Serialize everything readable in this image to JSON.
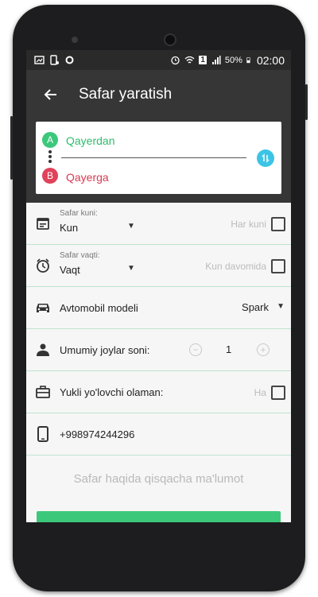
{
  "status_bar": {
    "battery": "50%",
    "time": "02:00",
    "sim": "1"
  },
  "app_bar": {
    "title": "Safar yaratish"
  },
  "route": {
    "from_badge": "A",
    "from_label": "Qayerdan",
    "to_badge": "B",
    "to_label": "Qayerga"
  },
  "date_row": {
    "label": "Safar kuni:",
    "value": "Kun",
    "daily_label": "Har kuni"
  },
  "time_row": {
    "label": "Safar vaqti:",
    "value": "Vaqt",
    "all_day_label": "Kun davomida"
  },
  "car_row": {
    "label": "Avtomobil modeli",
    "value": "Spark"
  },
  "seats_row": {
    "label": "Umumiy joylar soni:",
    "count": "1"
  },
  "cargo_row": {
    "label": "Yukli yo'lovchi olaman:",
    "yes_label": "Ha"
  },
  "phone_row": {
    "value": "+998974244296"
  },
  "description": {
    "placeholder": "Safar haqida qisqacha ma'lumot"
  },
  "colors": {
    "accent_green": "#3cc87b",
    "accent_red": "#e0435a",
    "appbar": "#363636",
    "swap_blue": "#3cc4e6"
  },
  "icons": [
    "back-arrow-icon",
    "swap-icon",
    "calendar-icon",
    "clock-icon",
    "car-icon",
    "person-icon",
    "briefcase-icon",
    "phone-icon",
    "dropdown-caret-icon",
    "minus-icon",
    "plus-icon"
  ]
}
